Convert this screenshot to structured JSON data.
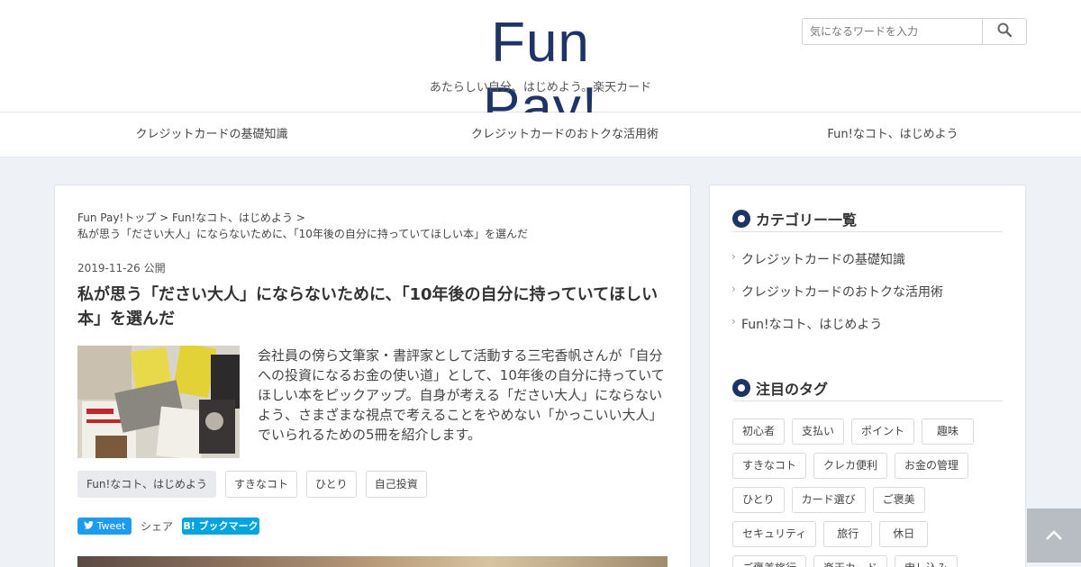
{
  "header": {
    "logo": "Fun Pay!",
    "tagline": "あたらしい自分、はじめよう。楽天カード",
    "search_placeholder": "気になるワードを入力",
    "search_icon": "search-icon"
  },
  "nav": {
    "items": [
      {
        "label": "クレジットカードの基礎知識"
      },
      {
        "label": "クレジットカードのおトクな活用術"
      },
      {
        "label": "Fun!なコト、はじめよう"
      }
    ]
  },
  "article": {
    "breadcrumb": {
      "home": "Fun Pay!トップ",
      "sep": ">",
      "category": "Fun!なコト、はじめよう",
      "current": "私が思う「ださい大人」にならないために、「10年後の自分に持っていてほしい本」を選んだ"
    },
    "date": "2019-11-26",
    "published": "公開",
    "title": "私が思う「ださい大人」にならないために、「10年後の自分に持っていてほしい本」を選んだ",
    "excerpt": "会社員の傍ら文筆家・書評家として活動する三宅香帆さんが「自分への投資になるお金の使い道」として、10年後の自分に持っていてほしい本をピックアップ。自身が考える「ださい大人」にならないよう、さまざまな視点で考えることをやめない「かっこいい大人」でいられるための5冊を紹介します。",
    "tags": [
      {
        "label": "Fun!なコト、はじめよう"
      },
      {
        "label": "すきなコト"
      },
      {
        "label": "ひとり"
      },
      {
        "label": "自己投資"
      }
    ],
    "share": {
      "tweet": "Tweet",
      "label": "シェア",
      "hatena": "ブックマーク",
      "hatena_mark": "B!"
    }
  },
  "sidebar": {
    "categories_title": "カテゴリー一覧",
    "categories": [
      {
        "label": "クレジットカードの基礎知識"
      },
      {
        "label": "クレジットカードのおトクな活用術"
      },
      {
        "label": "Fun!なコト、はじめよう"
      }
    ],
    "tags_title": "注目のタグ",
    "tag_rows": [
      [
        "初心者",
        "支払い",
        "ポイント",
        "趣味"
      ],
      [
        "すきなコト",
        "クレカ便利",
        "お金の管理"
      ],
      [
        "ひとり",
        "カード選び",
        "ご褒美"
      ],
      [
        "セキュリティ",
        "旅行",
        "休日"
      ],
      [
        "ご褒美旅行",
        "楽天カード",
        "申し込み"
      ]
    ]
  },
  "colors": {
    "brand": "#1e3466",
    "twitter": "#1d9bf0",
    "hatena": "#00a4de",
    "background": "#eef2f7"
  }
}
